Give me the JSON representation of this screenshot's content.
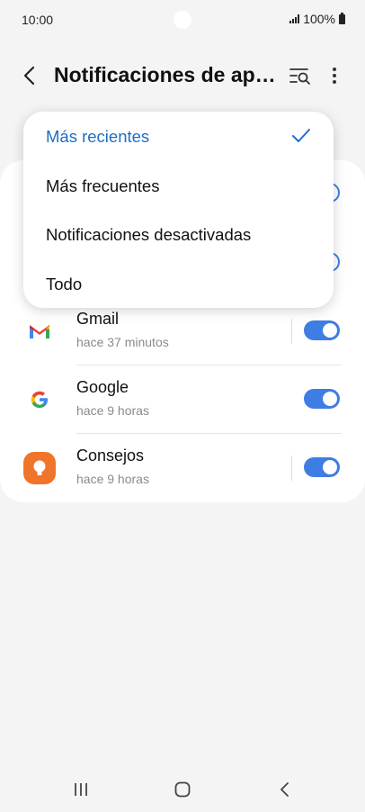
{
  "status_bar": {
    "time": "10:00",
    "battery": "100%"
  },
  "header": {
    "title": "Notificaciones de aplicaciones"
  },
  "dropdown": {
    "items": [
      {
        "label": "Más recientes",
        "selected": true
      },
      {
        "label": "Más frecuentes",
        "selected": false
      },
      {
        "label": "Notificaciones desactivadas",
        "selected": false
      },
      {
        "label": "Todo",
        "selected": false
      }
    ]
  },
  "apps": [
    {
      "name": "Gmail",
      "time": "hace 37 minutos",
      "icon": "gmail-icon",
      "enabled": true
    },
    {
      "name": "Google",
      "time": "hace 9 horas",
      "icon": "google-icon",
      "enabled": true
    },
    {
      "name": "Consejos",
      "time": "hace 9 horas",
      "icon": "tips-bulb-icon",
      "enabled": true
    }
  ],
  "colors": {
    "accent": "#3e7de4",
    "selected_text": "#1c6fc7",
    "tips_orange": "#f1742b"
  }
}
